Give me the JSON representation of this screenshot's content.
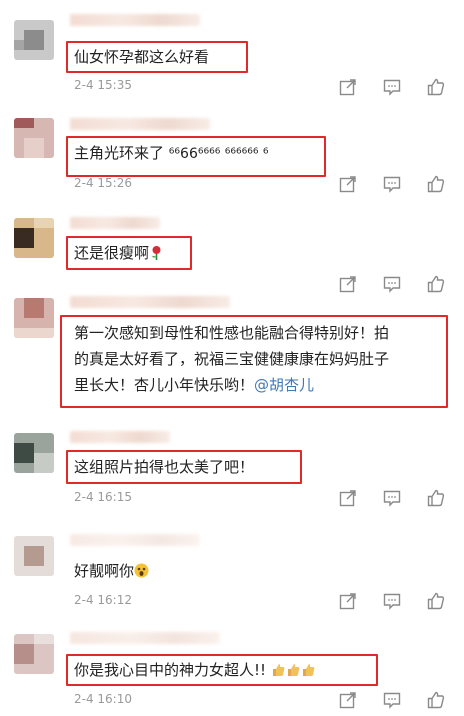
{
  "comments": [
    {
      "text": "仙女怀孕都这么好看",
      "date": "2-4 15:35"
    },
    {
      "text_main": "主角光环来了",
      "text_tail": [
        "⁶⁶",
        "66",
        "⁶⁶⁶⁶",
        " ⁶⁶⁶⁶⁶⁶",
        " ⁶"
      ],
      "date": "2-4 15:26"
    },
    {
      "text": "还是很瘦啊",
      "emoji": "rose-icon",
      "date": ""
    },
    {
      "lines": [
        "第一次感知到母性和性感也能融合得特别好！拍",
        "的真是太好看了，祝福三宝健健康康在妈妈肚子",
        "里长大！杏儿小年快乐哟！"
      ],
      "mention": "@胡杏儿",
      "date": ""
    },
    {
      "text": "这组照片拍得也太美了吧！",
      "date": "2-4 16:15"
    },
    {
      "text": "好靓啊你",
      "emoji": "shocked-face-icon",
      "date": "2-4 16:12"
    },
    {
      "text": "你是我心目中的神力女超人!!",
      "emoji": "thumbs-up-icon",
      "date": "2-4 16:10"
    }
  ],
  "colors": {
    "highlight": "#e02a2a",
    "mention": "#3f78b8",
    "date": "#9a9a9a"
  }
}
